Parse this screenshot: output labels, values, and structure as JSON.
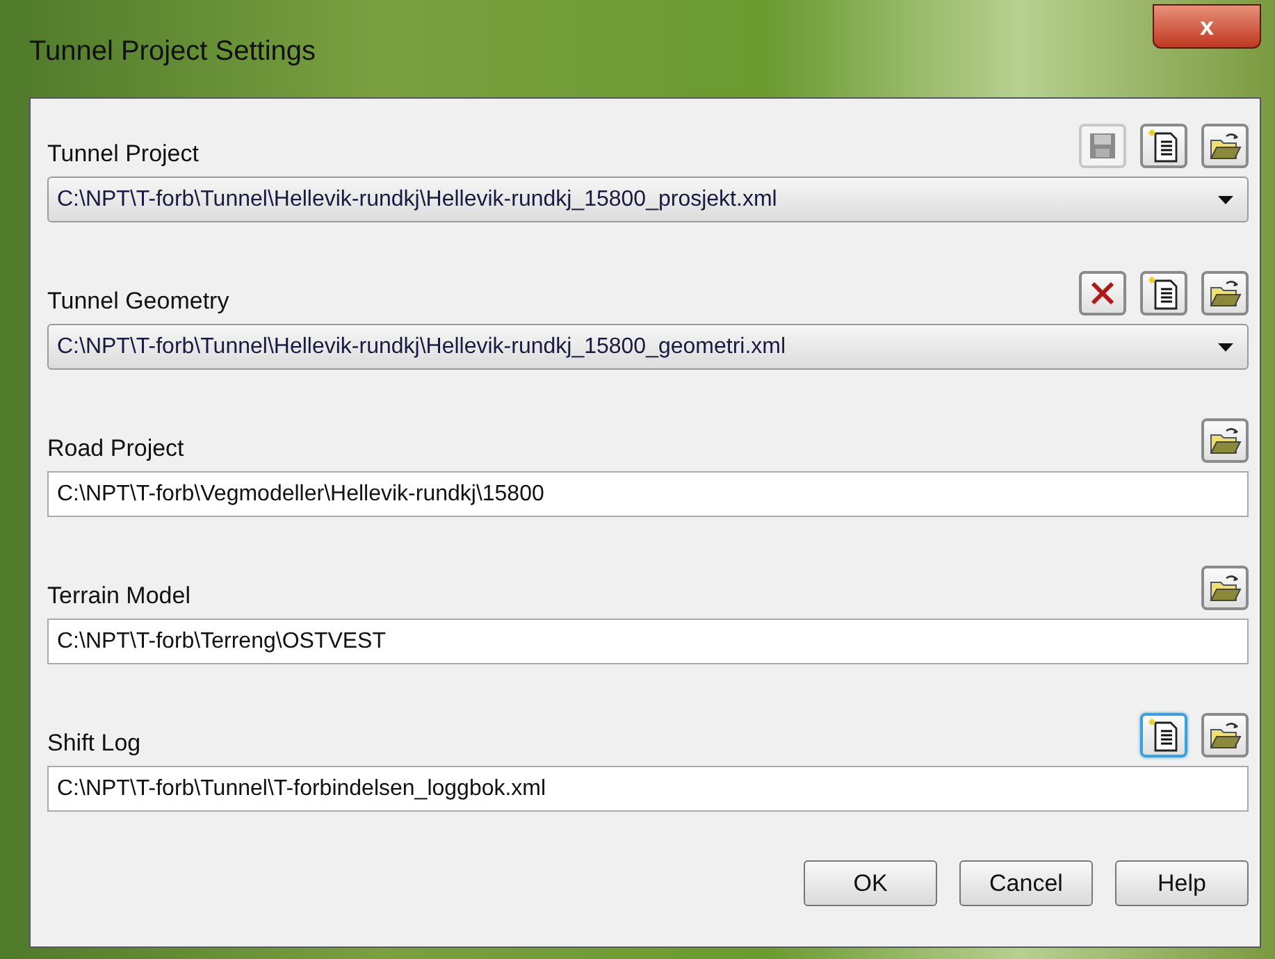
{
  "window": {
    "title": "Tunnel Project Settings",
    "close_label": "x"
  },
  "sections": [
    {
      "label": "Tunnel Project",
      "buttons": [
        {
          "kind": "save",
          "disabled": true,
          "focused": false
        },
        {
          "kind": "new",
          "disabled": false,
          "focused": false
        },
        {
          "kind": "open",
          "disabled": false,
          "focused": false
        }
      ],
      "field": {
        "kind": "dropdown",
        "value": "C:\\NPT\\T-forb\\Tunnel\\Hellevik-rundkj\\Hellevik-rundkj_15800_prosjekt.xml"
      }
    },
    {
      "label": "Tunnel Geometry",
      "buttons": [
        {
          "kind": "delete",
          "disabled": false,
          "focused": false
        },
        {
          "kind": "new",
          "disabled": false,
          "focused": false
        },
        {
          "kind": "open",
          "disabled": false,
          "focused": false
        }
      ],
      "field": {
        "kind": "dropdown",
        "value": "C:\\NPT\\T-forb\\Tunnel\\Hellevik-rundkj\\Hellevik-rundkj_15800_geometri.xml"
      }
    },
    {
      "label": "Road Project",
      "buttons": [
        {
          "kind": "open",
          "disabled": false,
          "focused": false
        }
      ],
      "field": {
        "kind": "text",
        "value": "C:\\NPT\\T-forb\\Vegmodeller\\Hellevik-rundkj\\15800"
      }
    },
    {
      "label": "Terrain Model",
      "buttons": [
        {
          "kind": "open",
          "disabled": false,
          "focused": false
        }
      ],
      "field": {
        "kind": "text",
        "value": "C:\\NPT\\T-forb\\Terreng\\OSTVEST"
      }
    },
    {
      "label": "Shift Log",
      "buttons": [
        {
          "kind": "new",
          "disabled": false,
          "focused": true
        },
        {
          "kind": "open",
          "disabled": false,
          "focused": false
        }
      ],
      "field": {
        "kind": "text",
        "value": "C:\\NPT\\T-forb\\Tunnel\\T-forbindelsen_loggbok.xml"
      }
    }
  ],
  "buttons": [
    "OK",
    "Cancel",
    "Help"
  ]
}
